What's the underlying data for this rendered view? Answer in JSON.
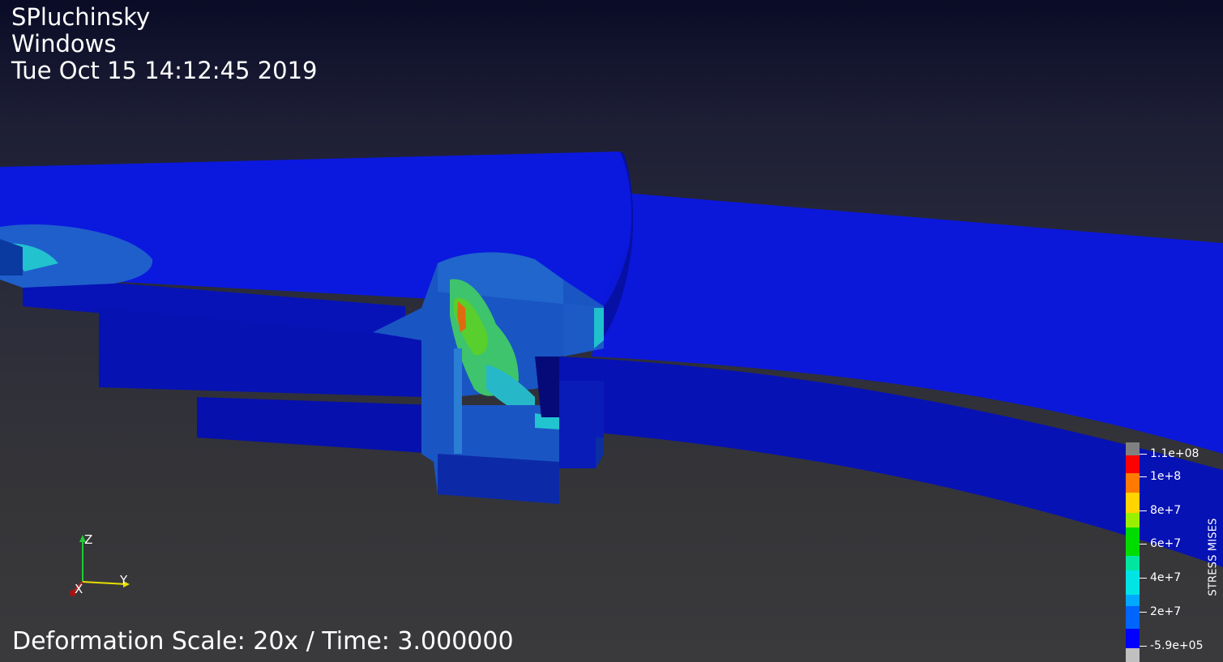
{
  "header": {
    "user": "SPluchinsky",
    "os": "Windows",
    "timestamp": "Tue Oct 15 14:12:45 2019"
  },
  "footer": {
    "info": "Deformation Scale: 20x / Time: 3.000000"
  },
  "legend": {
    "title": "STRESS MISES",
    "labels": [
      "1.1e+08",
      "1e+8",
      "8e+7",
      "6e+7",
      "4e+7",
      "2e+7",
      "-5.9e+05"
    ],
    "colors": {
      "above_range": "#808080",
      "red": "#ff0000",
      "orange": "#ff8000",
      "yellow": "#ffd000",
      "green_light": "#80ff00",
      "green": "#00e000",
      "cyan_light": "#00ffcc",
      "cyan": "#00c8ff",
      "blue_light": "#0070ff",
      "blue": "#0000ff",
      "below_range": "#c0c0c0"
    }
  },
  "axes": {
    "z": "Z",
    "y": "Y",
    "x": "X"
  },
  "colors": {
    "model_top": "#0b17e0",
    "model_side": "#0710b8",
    "model_shadow": "#050a8a",
    "stress_mid": "#1d63c9",
    "stress_cyan": "#1fbfd0",
    "stress_green": "#43c95e"
  }
}
